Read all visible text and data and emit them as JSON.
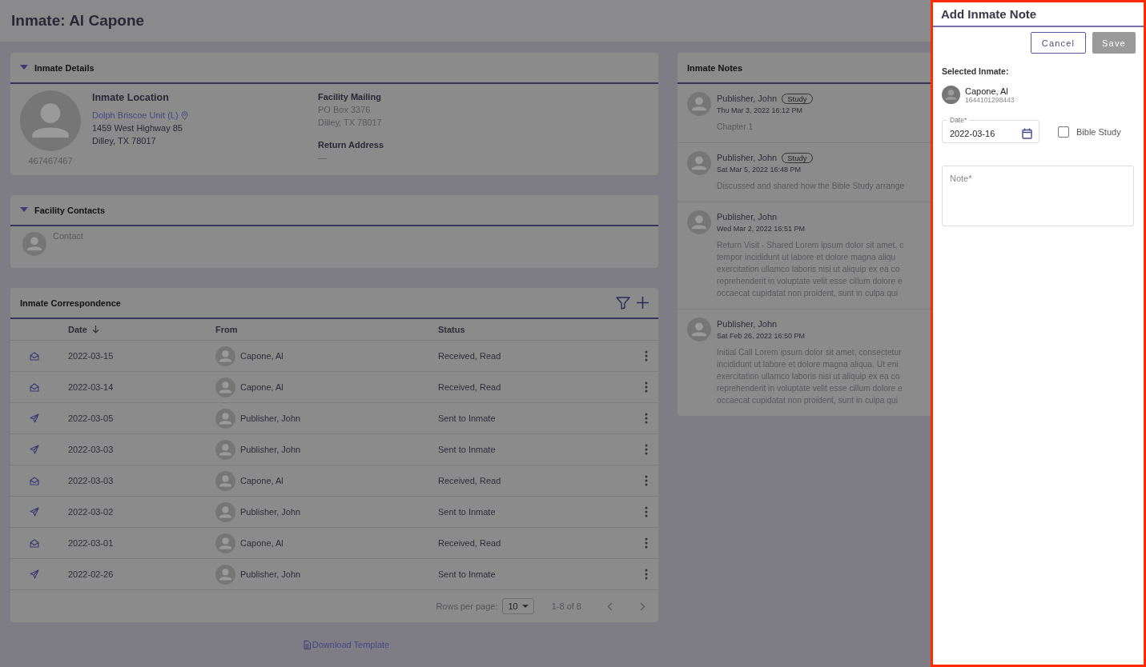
{
  "page": {
    "title": "Inmate: Al Capone"
  },
  "inmate_details": {
    "title": "Inmate Details",
    "expanded": true,
    "inmate_id": "467467467",
    "location_heading": "Inmate Location",
    "location_link": "Dolph Briscoe Unit (L)",
    "address_lines": [
      "1459 West Highway 85",
      "Dilley, TX 78017"
    ],
    "mailing_heading": "Facility Mailing",
    "mailing_lines": [
      "PO Box 3376",
      "Dilley, TX 78017"
    ],
    "return_heading": "Return Address",
    "return_value": "—"
  },
  "facility_contacts": {
    "title": "Facility Contacts",
    "expanded": true,
    "contacts": [
      {
        "name": "Contact"
      }
    ]
  },
  "correspondence": {
    "title": "Inmate Correspondence",
    "columns": [
      {
        "label": "Date",
        "sorted": true
      },
      {
        "label": "From",
        "sorted": false
      },
      {
        "label": "Status",
        "sorted": false
      }
    ],
    "rows": [
      {
        "kind": "received",
        "date": "2022-03-15",
        "from": "Capone, Al",
        "status": "Received, Read"
      },
      {
        "kind": "received",
        "date": "2022-03-14",
        "from": "Capone, Al",
        "status": "Received, Read"
      },
      {
        "kind": "sent",
        "date": "2022-03-05",
        "from": "Publisher, John",
        "status": "Sent to Inmate"
      },
      {
        "kind": "sent",
        "date": "2022-03-03",
        "from": "Publisher, John",
        "status": "Sent to Inmate"
      },
      {
        "kind": "received",
        "date": "2022-03-03",
        "from": "Capone, Al",
        "status": "Received, Read"
      },
      {
        "kind": "sent",
        "date": "2022-03-02",
        "from": "Publisher, John",
        "status": "Sent to Inmate"
      },
      {
        "kind": "received",
        "date": "2022-03-01",
        "from": "Capone, Al",
        "status": "Received, Read"
      },
      {
        "kind": "sent",
        "date": "2022-02-26",
        "from": "Publisher, John",
        "status": "Sent to Inmate"
      }
    ],
    "rows_per_page_label": "Rows per page:",
    "rows_per_page": "10",
    "range": "1-8 of 8"
  },
  "download_link": "Download Template",
  "notes": {
    "title": "Inmate Notes",
    "items": [
      {
        "author": "Publisher, John",
        "tag": "Study",
        "date": "Thu Mar 3, 2022 16:12 PM",
        "lines": [
          "Chapter 1"
        ]
      },
      {
        "author": "Publisher, John",
        "tag": "Study",
        "date": "Sat Mar 5, 2022 16:48 PM",
        "lines": [
          "Discussed and shared how the Bible Study arrange"
        ]
      },
      {
        "author": "Publisher, John",
        "date": "Wed Mar 2, 2022 16:51 PM",
        "lines": [
          "Return Visit - Shared Lorem ipsum dolor sit amet, c",
          "tempor incididunt ut labore et dolore magna aliqu",
          "exercitation ullamco laboris nisi ut aliquip ex ea co",
          "reprehenderit in voluptate velit esse cillum dolore e",
          "occaecat cupidatat non proident, sunt in culpa qui"
        ]
      },
      {
        "author": "Publisher, John",
        "date": "Sat Feb 26, 2022 16:50 PM",
        "lines": [
          "Initial Call Lorem ipsum dolor sit amet, consectetur",
          "incididunt ut labore et dolore magna aliqua. Ut eni",
          "exercitation ullamco laboris nisi ut aliquip ex ea co",
          "reprehenderit in voluptate velit esse cillum dolore e",
          "occaecat cupidatat non proident, sunt in culpa qui"
        ]
      }
    ]
  },
  "drawer": {
    "title": "Add Inmate Note",
    "cancel": "Cancel",
    "save": {
      "label": "Save",
      "disabled": true
    },
    "selected_label": "Selected Inmate:",
    "inmate": {
      "name": "Capone, Al",
      "id": "1644101298443"
    },
    "date": {
      "label": "Date*",
      "value": "2022-03-16"
    },
    "bible_study": {
      "label": "Bible Study",
      "checked": false
    },
    "note": {
      "placeholder": "Note*"
    }
  }
}
